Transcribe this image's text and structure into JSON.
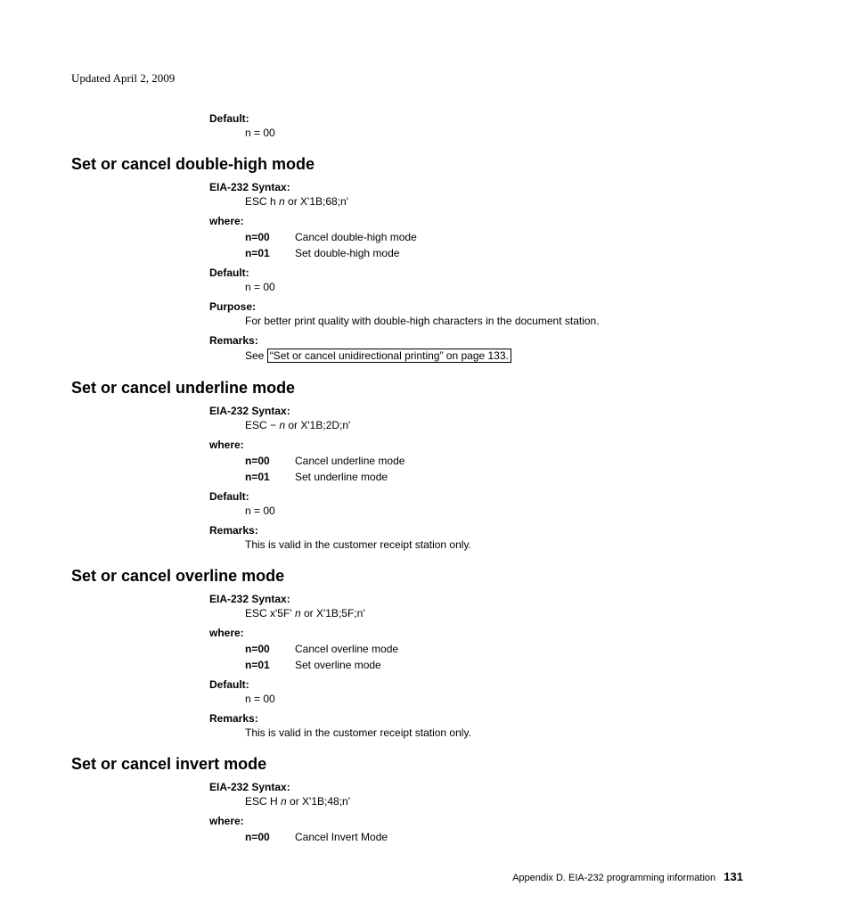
{
  "updated": "Updated April 2, 2009",
  "preDefault": {
    "label": "Default:",
    "value": "n = 00"
  },
  "sections": [
    {
      "heading": "Set or cancel double-high mode",
      "fields": [
        {
          "label": "EIA-232 Syntax:",
          "text": {
            "prefix": "ESC h ",
            "ital": "n",
            "suffix": " or X'1B;68;n'"
          }
        },
        {
          "label": "where:",
          "params": [
            {
              "k": "n=00",
              "v": "Cancel double-high mode"
            },
            {
              "k": "n=01",
              "v": "Set double-high mode"
            }
          ]
        },
        {
          "label": "Default:",
          "plain": "n = 00"
        },
        {
          "label": "Purpose:",
          "plain": "For better print quality with double-high characters in the document station."
        },
        {
          "label": "Remarks:",
          "linkPrefix": "See ",
          "linkText": "“Set or cancel unidirectional printing” on page 133."
        }
      ]
    },
    {
      "heading": "Set or cancel underline mode",
      "fields": [
        {
          "label": "EIA-232 Syntax:",
          "text": {
            "prefix": "ESC − ",
            "ital": "n",
            "suffix": " or X'1B;2D;n'"
          }
        },
        {
          "label": "where:",
          "params": [
            {
              "k": "n=00",
              "v": "Cancel underline mode"
            },
            {
              "k": "n=01",
              "v": "Set underline mode"
            }
          ]
        },
        {
          "label": "Default:",
          "plain": "n = 00"
        },
        {
          "label": "Remarks:",
          "plain": "This is valid in the customer receipt station only."
        }
      ]
    },
    {
      "heading": "Set or cancel overline mode",
      "fields": [
        {
          "label": "EIA-232 Syntax:",
          "text": {
            "prefix": "ESC x'5F' ",
            "ital": "n",
            "suffix": " or X'1B;5F;n'"
          }
        },
        {
          "label": "where:",
          "params": [
            {
              "k": "n=00",
              "v": "Cancel overline mode"
            },
            {
              "k": "n=01",
              "v": "Set overline mode"
            }
          ]
        },
        {
          "label": "Default:",
          "plain": "n = 00"
        },
        {
          "label": "Remarks:",
          "plain": "This is valid in the customer receipt station only."
        }
      ]
    },
    {
      "heading": "Set or cancel invert mode",
      "fields": [
        {
          "label": "EIA-232 Syntax:",
          "text": {
            "prefix": "ESC H ",
            "ital": "n",
            "suffix": " or X'1B;48;n'"
          }
        },
        {
          "label": "where:",
          "params": [
            {
              "k": "n=00",
              "v": "Cancel Invert Mode"
            }
          ]
        }
      ]
    }
  ],
  "footer": {
    "text": "Appendix D. EIA-232 programming information",
    "page": "131"
  }
}
